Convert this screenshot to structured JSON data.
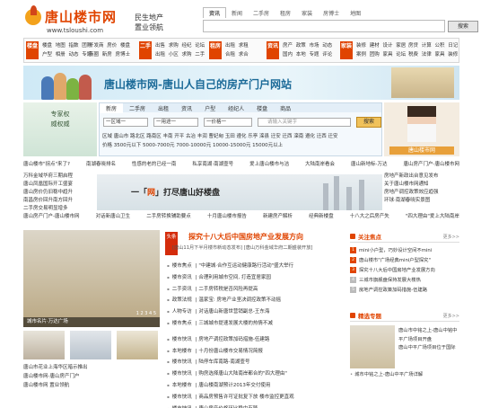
{
  "header": {
    "brand": "唐山楼市网",
    "url": "www.tsloushi.com",
    "slogan1": "民生地产",
    "slogan2": "置业领航",
    "tabs": [
      "资讯",
      "新闻",
      "二手房",
      "租房",
      "家装",
      "房博士",
      "地图"
    ],
    "search_button": "搜索"
  },
  "nav": {
    "groups": [
      {
        "tag": "楼盘",
        "lines": [
          "楼盘 地图 指数 团购",
          "户型 相册 动态 专题"
        ]
      },
      {
        "tag": "新房",
        "lines": [
          "开发商 房价 楼盘",
          "商圈 新房 房博士"
        ]
      },
      {
        "tag": "二手",
        "lines": [
          "出售 求购 经纪 论坛",
          "出租 小区 求购 二手"
        ]
      },
      {
        "tag": "租房",
        "lines": [
          "出租 求租",
          "合租 求合"
        ]
      },
      {
        "tag": "资讯",
        "lines": [
          "房产 政策 市场 动态",
          "国内 本地 专题 评论"
        ]
      },
      {
        "tag": "家装",
        "lines": [
          "装修 建材 设计 家居",
          "案例 团购 家具 论坛"
        ]
      },
      {
        "tag": "服务",
        "lines": [
          "房贷 计算 公积 日记",
          "税费 法律 家具 装修"
        ]
      }
    ]
  },
  "banner": {
    "text": "唐山楼市网-唐山人自己的房产门户网站"
  },
  "leftad": {
    "text": "专家权威权威"
  },
  "rightad": {
    "caption": "唐山楼市网"
  },
  "search_box": {
    "tabs": [
      "新房",
      "二手房",
      "出租",
      "资讯",
      "户型",
      "经纪人",
      "楼盘",
      "商品"
    ],
    "area_select": "一区域一",
    "type_select": "一用途一",
    "price_select": "一价格一",
    "keyword_placeholder": "请输入关键字",
    "search_button": "搜索",
    "area_line1": "区域 唐山市 路北区 路南区 丰南 开平 古冶 丰润 曹妃甸 玉田 遵化 乐亭 滦县 迁安 迁西 滦南 遵化 迁西 迁安",
    "area_line2": "价格 3500元以下 5000-7000元 7000-10000元 10000-15000元 15000元以上"
  },
  "strip": {
    "row1": [
      "唐山楼市\"拐点\"来了?",
      "南湖春晓排名",
      "性感的老的已经一南",
      "私享南湖·南湖壹号",
      "爱上唐山楼市与洁",
      "大陆南岸看会",
      "唐山新地标-万达",
      "唐山房产门户-唐山楼市网"
    ],
    "row2": [
      "万科金域华府三期启程",
      "",
      "",
      "",
      "",
      "",
      "",
      "房地产新政出台意见发布"
    ]
  },
  "mid_left_list": [
    "唐山凤凰国际开工盛宴",
    "唐山房价仍旧稳中趋升",
    "南昌房价回升南方回升",
    "二手房交易明显增多"
  ],
  "mid_banner": {
    "text_prefix": "一「",
    "text_hot": "网",
    "text_suffix": "」打尽唐山好楼盘"
  },
  "mid_right_list": [
    "关于唐山楼市网通知",
    "房地产调控政策效应趋强",
    "环球·南湖春晓实景图"
  ],
  "strip2": [
    "唐山房产门户-唐山楼市网",
    "对话新唐山卫生",
    "二手房转换辅助要点",
    "十月唐山楼市报告",
    "新建住宅时发",
    "新建房产解析",
    "经典新楼盘",
    "十八大之后房产失",
    "\"四大理由\"爱上大陆南岸"
  ],
  "photo": {
    "caption": "城市名片·万达广场",
    "pager": "1 2 3 4 5"
  },
  "bottom_left_list": [
    "唐山市花业上海华区暗示推出",
    "唐山楼市网-唐山房产门户",
    "唐山楼市网 置业领航"
  ],
  "headline": {
    "badge": "头条",
    "title": "探究十八大后中国房地产业发展方向",
    "sub": "[唐山11月下半月楼市新动态发布] [唐山万科金域华府二期盛装开放]"
  },
  "center_list": [
    {
      "cat": "楼市焦点",
      "text": "\"中建城·合作互运动健康路行活动\"盛大举行"
    },
    {
      "cat": "楼市资讯",
      "text": "合理利用城市空间, 打造宜居家园"
    },
    {
      "cat": "二手资讯",
      "text": "二手房转税是否风险再提高"
    },
    {
      "cat": "政策法规",
      "text": "温家宝: 房地产业坚决调控政策不动摇"
    },
    {
      "cat": "人物专访",
      "text": "对话唐山新唐世营销副总-王东海"
    },
    {
      "cat": "楼市焦点",
      "text": "三城城市提速发展大楼的热情不减"
    },
    {
      "sep": true
    },
    {
      "cat": "楼市快讯",
      "text": "房地产调控政策加码措施-伍建路"
    },
    {
      "cat": "本地楼市",
      "text": "十月份唐山楼市交易情况简报"
    },
    {
      "cat": "楼市快讯",
      "text": "陆停车库南路-南湖壹号"
    },
    {
      "cat": "楼市快讯",
      "text": "购房选择唐山大陆南岸都合的\"四大理由\""
    },
    {
      "cat": "本地楼市",
      "text": "唐山楼南湖预计2013年交付使用"
    },
    {
      "cat": "楼市快讯",
      "text": "商品房预售许可证批复下放 楼市监控更直观"
    },
    {
      "cat": "楼市快讯",
      "text": "唐山房产价格环比稳中有降"
    }
  ],
  "right_col": {
    "head1": "关注焦点",
    "more": "更多>>",
    "list": [
      {
        "n": "1",
        "text": "mini小户型，巧妙设计空间不mini"
      },
      {
        "n": "2",
        "text": "唐山楼市\"广场经典mini户型探究\""
      },
      {
        "n": "3",
        "text": "探究十八大后中国房地产业发展方向"
      },
      {
        "n": "4",
        "text": "三城市旗舰盘保持发展大楼热"
      },
      {
        "n": "5",
        "text": "房地产调控政策加码措施-伍建路"
      }
    ],
    "head2": "精选专题",
    "photo_text": [
      "唐山市中铭之上-唐山中铭中平广场项目开盘",
      "唐山中平广场项目位于国际"
    ],
    "bottom": [
      "城市中铭之上-唐山中平广场详解"
    ]
  }
}
